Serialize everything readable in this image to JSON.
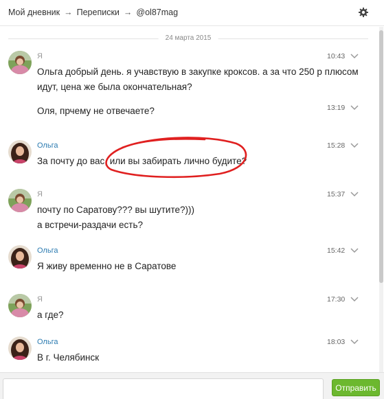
{
  "breadcrumb": {
    "items": [
      "Мой дневник",
      "Переписки",
      "@ol87mag"
    ],
    "separator": "→"
  },
  "date_divider": "24 марта 2015",
  "messages": [
    {
      "author": "Я",
      "author_type": "me",
      "time": "10:43",
      "lines": [
        "Ольга добрый день. я учавствую в закупке кроксов. а за что 250 р плюсом",
        "идут, цена же была окончательная?"
      ]
    },
    {
      "author": "",
      "author_type": "me",
      "time": "13:19",
      "continuation": true,
      "lines": [
        "Оля, прчему не отвечаете?"
      ]
    },
    {
      "author": "Ольга",
      "author_type": "other",
      "time": "15:28",
      "lines": [
        "За почту до вас, или вы забирать лично будите?"
      ]
    },
    {
      "author": "Я",
      "author_type": "me",
      "time": "15:37",
      "lines": [
        "почту по Саратову??? вы шутите?)))",
        "а встречи-раздачи есть?"
      ]
    },
    {
      "author": "Ольга",
      "author_type": "other",
      "time": "15:42",
      "lines": [
        "Я живу временно не в Саратове"
      ]
    },
    {
      "author": "Я",
      "author_type": "me",
      "time": "17:30",
      "lines": [
        "а где?"
      ]
    },
    {
      "author": "Ольга",
      "author_type": "other",
      "time": "18:03",
      "lines": [
        "В г. Челябинск"
      ]
    }
  ],
  "composer": {
    "value": "",
    "placeholder": ""
  },
  "send_button": "Отправить",
  "colors": {
    "send": "#6cb82f",
    "author_other": "#2a7ab0",
    "annotation": "#e02020"
  },
  "icons": {
    "settings": "gear-icon",
    "message_menu": "chevron-down-icon"
  }
}
